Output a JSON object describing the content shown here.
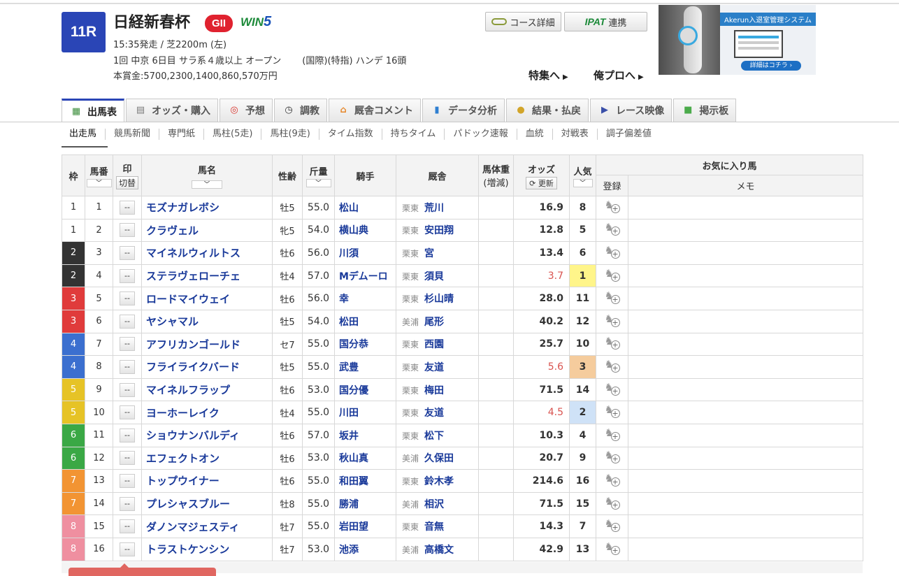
{
  "race": {
    "number": "11R",
    "name": "日経新春杯",
    "grade": "GII",
    "win5_prefix": "WIN",
    "win5_suffix": "5",
    "start_info": "15:35発走 / 芝2200m (左)",
    "meeting_info": "1回 中京 6日目 サラ系４歳以上 オープン",
    "condition_info": "(国際)(特指) ハンデ 16頭",
    "prize_info": "本賞金:5700,2300,1400,860,570万円"
  },
  "header_buttons": {
    "course_detail": "コース詳細",
    "ipat_logo": "IPAT",
    "ipat_link": "連携"
  },
  "header_links": {
    "special": "特集へ",
    "pro": "俺プロへ",
    "arrow": "▶"
  },
  "ad": {
    "title": "Akerun入退室管理システム",
    "cta": "詳細はコチラ ›"
  },
  "main_tabs": [
    {
      "label": "出馬表",
      "icon": "table-icon",
      "glyph": "▦",
      "color": "#3a8d3a"
    },
    {
      "label": "オッズ・購入",
      "icon": "odds-icon",
      "glyph": "▤",
      "color": "#7a7a7a"
    },
    {
      "label": "予想",
      "icon": "target-icon",
      "glyph": "◎",
      "color": "#d9332c"
    },
    {
      "label": "調教",
      "icon": "stopwatch-icon",
      "glyph": "◷",
      "color": "#333333"
    },
    {
      "label": "厩舎コメント",
      "icon": "stable-icon",
      "glyph": "⌂",
      "color": "#e6872a"
    },
    {
      "label": "データ分析",
      "icon": "bar-chart-icon",
      "glyph": "▮",
      "color": "#2f7fd1"
    },
    {
      "label": "結果・払戻",
      "icon": "coins-icon",
      "glyph": "●",
      "color": "#d2a52a"
    },
    {
      "label": "レース映像",
      "icon": "video-icon",
      "glyph": "▶",
      "color": "#3a4fa8"
    },
    {
      "label": "掲示板",
      "icon": "chat-icon",
      "glyph": "■",
      "color": "#4bab4b"
    }
  ],
  "sub_tabs": [
    "出走馬",
    "競馬新聞",
    "専門紙",
    "馬柱(5走)",
    "馬柱(9走)",
    "タイム指数",
    "持ちタイム",
    "パドック速報",
    "血統",
    "対戦表",
    "調子偏差値"
  ],
  "table_headers": {
    "waku": "枠",
    "umaban": "馬番",
    "mark": "印",
    "mark_switch": "切替",
    "name": "馬名",
    "sex_age": "性齢",
    "weight": "斤量",
    "jockey": "騎手",
    "stable": "厩舎",
    "body_weight": "馬体重",
    "body_weight_sub": "(増減)",
    "odds": "オッズ",
    "refresh": "更新",
    "popularity": "人気",
    "favorite": "お気に入り馬",
    "register": "登録",
    "memo": "メモ",
    "sort_arrow": "﹀"
  },
  "waku_colors": {
    "1": {
      "bg": "#ffffff",
      "fg": "#333333"
    },
    "2": {
      "bg": "#333333",
      "fg": "#ffffff"
    },
    "3": {
      "bg": "#e03b3b",
      "fg": "#ffffff"
    },
    "4": {
      "bg": "#3b6fcf",
      "fg": "#ffffff"
    },
    "5": {
      "bg": "#e6c326",
      "fg": "#ffffff"
    },
    "6": {
      "bg": "#3aa845",
      "fg": "#ffffff"
    },
    "7": {
      "bg": "#f29433",
      "fg": "#ffffff"
    },
    "8": {
      "bg": "#ef8fa0",
      "fg": "#ffffff"
    }
  },
  "mark_placeholder": "--",
  "horses": [
    {
      "waku": "1",
      "num": "1",
      "name": "モズナガレボシ",
      "sex_age": "牡5",
      "weight": "55.0",
      "jockey": "松山",
      "area": "栗東",
      "trainer": "荒川",
      "odds": "16.9",
      "pop": "8"
    },
    {
      "waku": "1",
      "num": "2",
      "name": "クラヴェル",
      "sex_age": "牝5",
      "weight": "54.0",
      "jockey": "横山典",
      "area": "栗東",
      "trainer": "安田翔",
      "odds": "12.8",
      "pop": "5"
    },
    {
      "waku": "2",
      "num": "3",
      "name": "マイネルウィルトス",
      "sex_age": "牡6",
      "weight": "56.0",
      "jockey": "川須",
      "area": "栗東",
      "trainer": "宮",
      "odds": "13.4",
      "pop": "6"
    },
    {
      "waku": "2",
      "num": "4",
      "name": "ステラヴェローチェ",
      "sex_age": "牡4",
      "weight": "57.0",
      "jockey": "Mデムーロ",
      "area": "栗東",
      "trainer": "須貝",
      "odds": "3.7",
      "pop": "1"
    },
    {
      "waku": "3",
      "num": "5",
      "name": "ロードマイウェイ",
      "sex_age": "牡6",
      "weight": "56.0",
      "jockey": "幸",
      "area": "栗東",
      "trainer": "杉山晴",
      "odds": "28.0",
      "pop": "11"
    },
    {
      "waku": "3",
      "num": "6",
      "name": "ヤシャマル",
      "sex_age": "牡5",
      "weight": "54.0",
      "jockey": "松田",
      "area": "美浦",
      "trainer": "尾形",
      "odds": "40.2",
      "pop": "12"
    },
    {
      "waku": "4",
      "num": "7",
      "name": "アフリカンゴールド",
      "sex_age": "セ7",
      "weight": "55.0",
      "jockey": "国分恭",
      "area": "栗東",
      "trainer": "西園",
      "odds": "25.7",
      "pop": "10"
    },
    {
      "waku": "4",
      "num": "8",
      "name": "フライライクバード",
      "sex_age": "牡5",
      "weight": "55.0",
      "jockey": "武豊",
      "area": "栗東",
      "trainer": "友道",
      "odds": "5.6",
      "pop": "3"
    },
    {
      "waku": "5",
      "num": "9",
      "name": "マイネルフラップ",
      "sex_age": "牡6",
      "weight": "53.0",
      "jockey": "国分優",
      "area": "栗東",
      "trainer": "梅田",
      "odds": "71.5",
      "pop": "14"
    },
    {
      "waku": "5",
      "num": "10",
      "name": "ヨーホーレイク",
      "sex_age": "牡4",
      "weight": "55.0",
      "jockey": "川田",
      "area": "栗東",
      "trainer": "友道",
      "odds": "4.5",
      "pop": "2"
    },
    {
      "waku": "6",
      "num": "11",
      "name": "ショウナンバルディ",
      "sex_age": "牡6",
      "weight": "57.0",
      "jockey": "坂井",
      "area": "栗東",
      "trainer": "松下",
      "odds": "10.3",
      "pop": "4"
    },
    {
      "waku": "6",
      "num": "12",
      "name": "エフェクトオン",
      "sex_age": "牡6",
      "weight": "53.0",
      "jockey": "秋山真",
      "area": "美浦",
      "trainer": "久保田",
      "odds": "20.7",
      "pop": "9"
    },
    {
      "waku": "7",
      "num": "13",
      "name": "トップウイナー",
      "sex_age": "牡6",
      "weight": "55.0",
      "jockey": "和田翼",
      "area": "栗東",
      "trainer": "鈴木孝",
      "odds": "214.6",
      "pop": "16"
    },
    {
      "waku": "7",
      "num": "14",
      "name": "プレシャスブルー",
      "sex_age": "牡8",
      "weight": "55.0",
      "jockey": "勝浦",
      "area": "美浦",
      "trainer": "相沢",
      "odds": "71.5",
      "pop": "15"
    },
    {
      "waku": "8",
      "num": "15",
      "name": "ダノンマジェスティ",
      "sex_age": "牡7",
      "weight": "55.0",
      "jockey": "岩田望",
      "area": "栗東",
      "trainer": "音無",
      "odds": "14.3",
      "pop": "7"
    },
    {
      "waku": "8",
      "num": "16",
      "name": "トラストケンシン",
      "sex_age": "牡7",
      "weight": "53.0",
      "jockey": "池添",
      "area": "美浦",
      "trainer": "高橋文",
      "odds": "42.9",
      "pop": "13"
    }
  ]
}
